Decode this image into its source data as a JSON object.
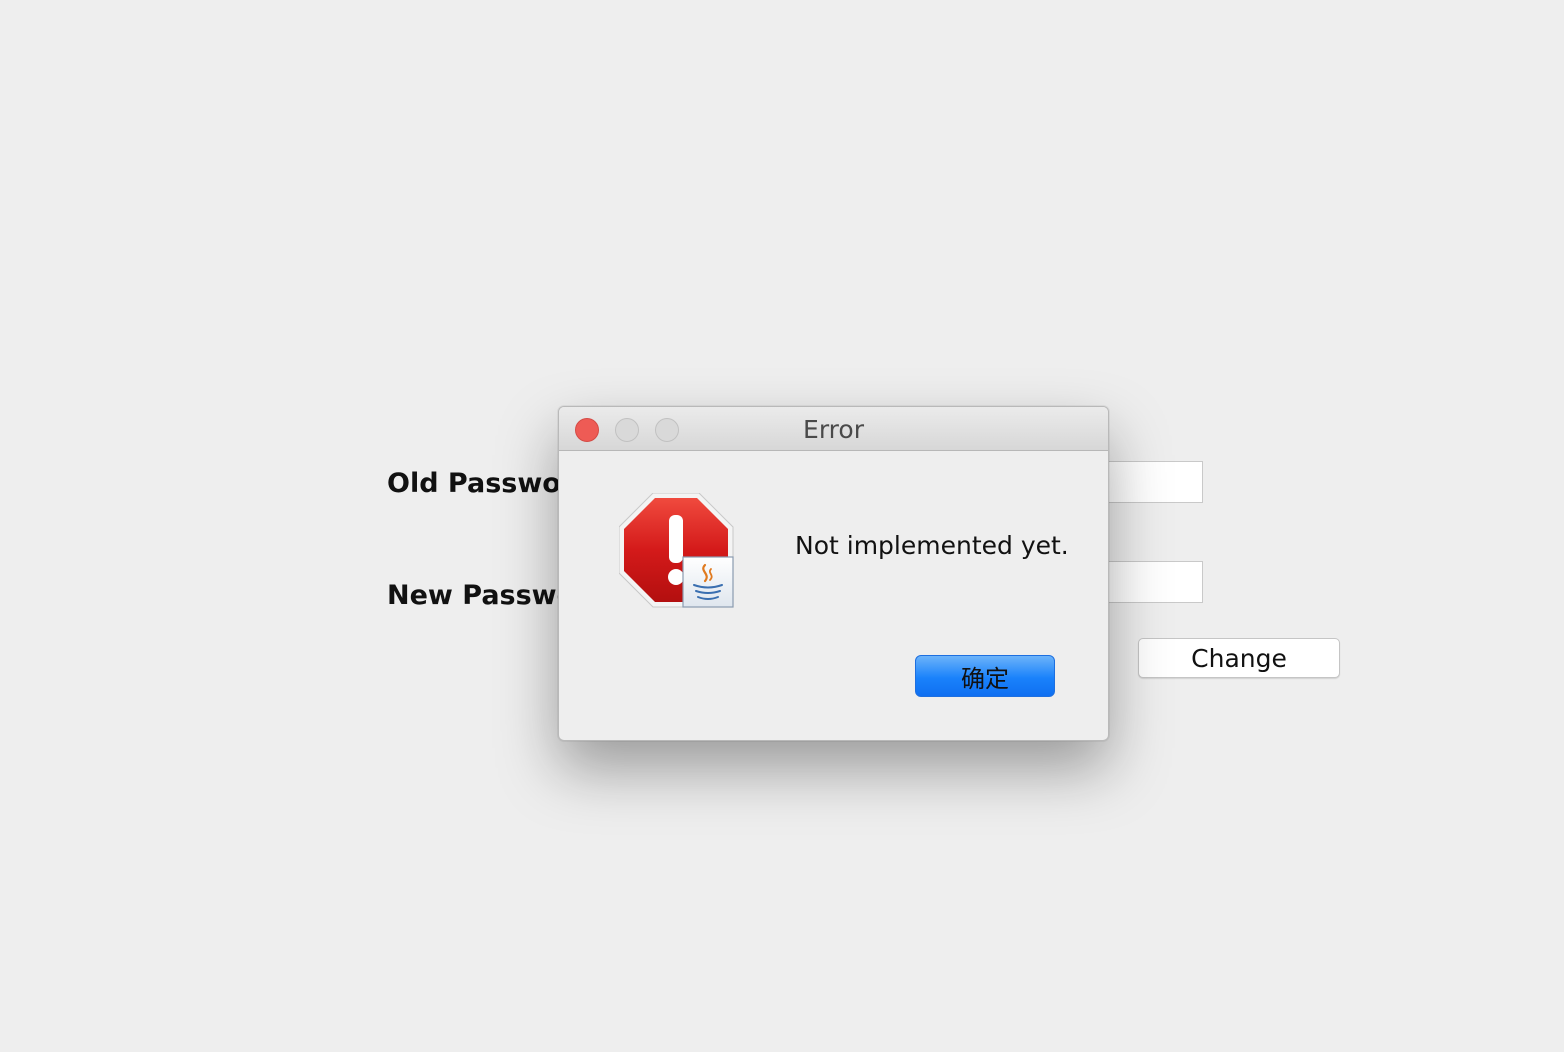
{
  "form": {
    "old_password_label": "Old Passwo",
    "new_password_label": "New Passwo",
    "change_button_label": "Change"
  },
  "dialog": {
    "title": "Error",
    "message": "Not implemented yet.",
    "ok_button_label": "确定",
    "icon": "error-stop-sign-with-java-badge-icon",
    "window_controls": [
      "close",
      "minimize",
      "zoom"
    ]
  },
  "colors": {
    "background": "#eeeeee",
    "close_button": "#ee5b55",
    "ok_button": "#1a82fb",
    "error_icon": "#d41a1a"
  }
}
